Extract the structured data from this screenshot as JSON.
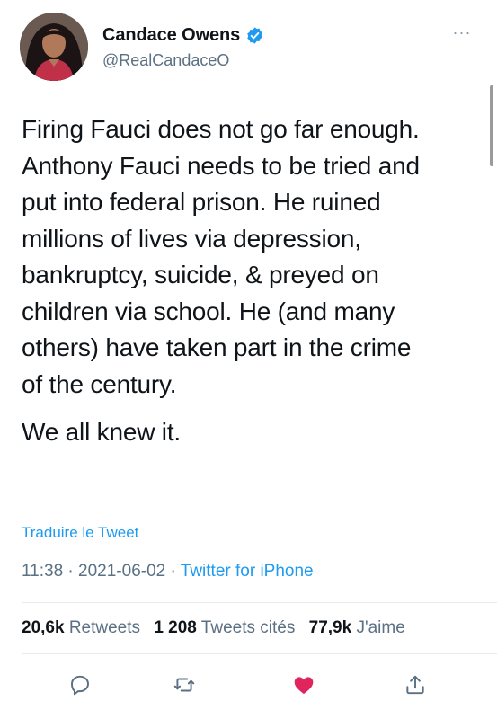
{
  "author": {
    "display_name": "Candace Owens",
    "handle": "@RealCandaceO",
    "verified": true
  },
  "more_menu": {
    "label": "···"
  },
  "tweet": {
    "paragraphs": [
      "Firing Fauci does not go far enough.\nAnthony Fauci needs to be tried and\nput into federal prison. He ruined\nmillions of lives via depression,\nbankruptcy, suicide, & preyed on\nchildren via school. He (and many\nothers) have taken part in the crime\nof the century.",
      "We all knew it."
    ],
    "translate_label": "Traduire le Tweet",
    "time": "11:38",
    "separator": " · ",
    "date": "2021-06-02",
    "source": "Twitter for iPhone"
  },
  "stats": {
    "retweets_count": "20,6k",
    "retweets_label": "Retweets",
    "quotes_count": "1 208",
    "quotes_label": "Tweets cités",
    "likes_count": "77,9k",
    "likes_label": "J'aime"
  },
  "actions": {
    "icons": [
      "reply-icon",
      "retweet-icon",
      "like-icon",
      "share-icon"
    ],
    "accent_color": "#1d9bf0",
    "like_color": "#e0245e",
    "icon_color": "#5b7083"
  }
}
